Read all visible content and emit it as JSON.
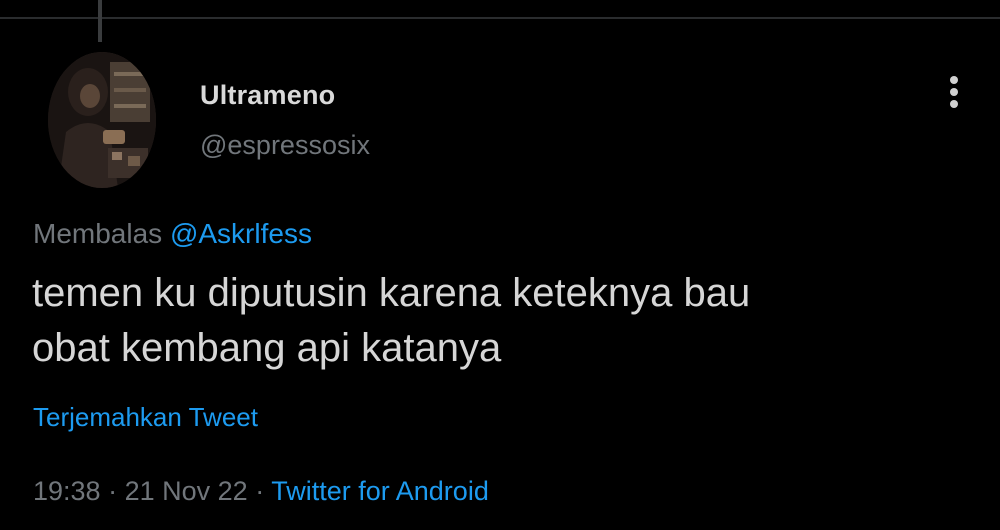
{
  "tweet": {
    "author": {
      "display_name": "Ultrameno",
      "handle": "@espressosix"
    },
    "reply_prefix": "Membalas",
    "reply_mention": "@Askrlfess",
    "text_line_1": "temen ku diputusin karena keteknya bau",
    "text_line_2": "obat kembang api katanya",
    "translate_label": "Terjemahkan Tweet",
    "time": "19:38",
    "separator": "·",
    "date": "21 Nov 22",
    "source": "Twitter for Android"
  },
  "icons": {
    "more": "more-vertical-icon"
  },
  "colors": {
    "background": "#000000",
    "link": "#1d9bf0",
    "secondary_text": "#71767b",
    "primary_text": "#d6d6d6"
  }
}
